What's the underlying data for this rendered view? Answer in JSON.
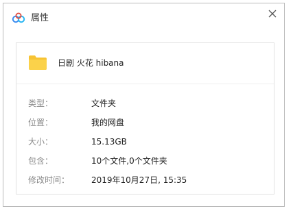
{
  "window": {
    "title": "属性",
    "app_icon": "baidu-netdisk-cloud-icon",
    "close_icon": "close-icon"
  },
  "file": {
    "icon": "folder-icon",
    "name": "日剧 火花 hibana"
  },
  "properties": [
    {
      "label": "类型：",
      "value": "文件夹"
    },
    {
      "label": "位置：",
      "value": "我的网盘"
    },
    {
      "label": "大小：",
      "value": "15.13GB"
    },
    {
      "label": "包含：",
      "value": "10个文件,0个文件夹"
    },
    {
      "label": "修改时间：",
      "value": "2019年10月27日, 15:35"
    }
  ],
  "colors": {
    "folder": "#f7c333",
    "cloud_blue": "#3b8cf0",
    "label_gray": "#8a8a8a"
  }
}
